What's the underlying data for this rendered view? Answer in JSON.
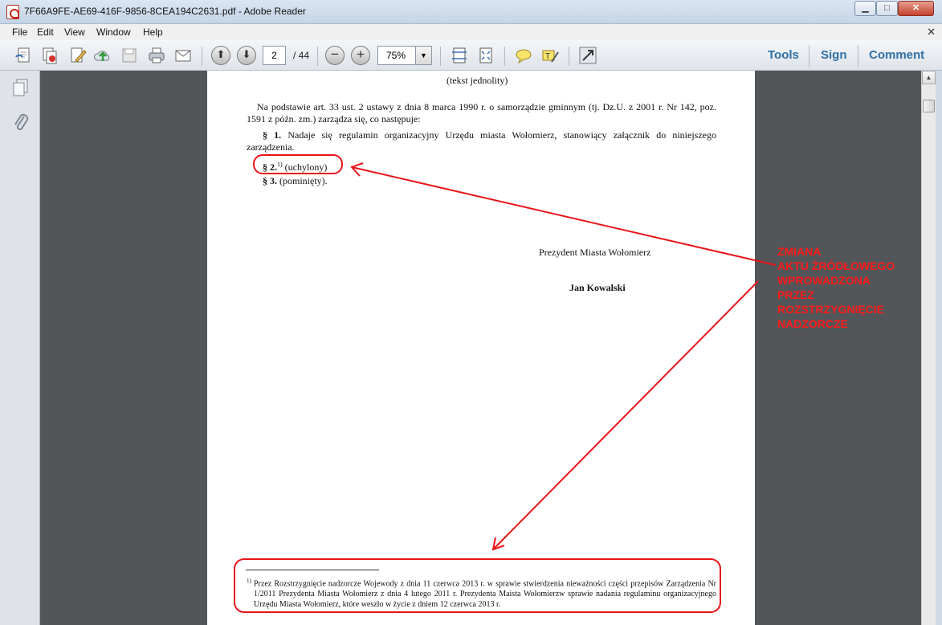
{
  "window": {
    "title": "7F66A9FE-AE69-416F-9856-8CEA194C2631.pdf - Adobe Reader",
    "min_glyph": "▁",
    "max_glyph": "□",
    "close_glyph": "✕"
  },
  "menu": {
    "items": [
      "File",
      "Edit",
      "View",
      "Window",
      "Help"
    ],
    "close_glyph": "✕"
  },
  "toolbar": {
    "icons": [
      "create-pdf-icon",
      "combine-icon",
      "edit-icon",
      "upload-icon",
      "save-icon",
      "print-icon",
      "email-icon",
      "prev-page-icon",
      "next-page-icon",
      "zoom-out-icon",
      "zoom-in-icon",
      "fit-page-icon",
      "fit-width-icon",
      "comment-bubble-icon",
      "highlight-icon",
      "fullscreen-icon"
    ],
    "page_current": "2",
    "page_total": "/ 44",
    "zoom": "75%",
    "prev_glyph": "⬆",
    "next_glyph": "⬇",
    "zoom_out_glyph": "−",
    "zoom_in_glyph": "+",
    "zoom_dropdown_glyph": "▼",
    "right_tabs": [
      "Tools",
      "Sign",
      "Comment"
    ]
  },
  "navpane": {
    "icons": [
      "pages-icon",
      "attachments-icon"
    ]
  },
  "document": {
    "subtitle": "(tekst jednolity)",
    "intro": "Na podstawie art. 33 ust. 2 ustawy z dnia 8 marca 1990 r. o samorządzie gminnym (tj. Dz.U. z 2001 r. Nr 142, poz. 1591 z późn. zm.) zarządza się, co następuje:",
    "par1_num": "§ 1.",
    "par1_text": " Nadaje się regulamin organizacyjny Urzędu miasta Wołomierz, stanowiący załącznik do niniejszego zarządzenia.",
    "par2_num": "§ 2.",
    "par2_sup": "1)",
    "par2_text": " (uchylony)",
    "par3_num": "§ 3.",
    "par3_text": " (pominięty).",
    "signature_title": "Prezydent Miasta Wołomierz",
    "signature_name": "Jan Kowalski",
    "footnote_mark": "1)",
    "footnote": "Przez Rozstrzygnięcie nadzorcze Wojewody z dnia 11 czerwca 2013 r. w sprawie stwierdzenia nieważności części przepisów Zarządzenia Nr 1/2011 Prezydenta Miasta Wołomierz z dnia 4 lutego 2011 r. Prezydenta Maista Wołomierzw sprawie nadania regulaminu organizacyjnego Urzędu Miasta Wołomierz, które weszło w życie z dniem 12 czerwca 2013 r."
  },
  "scrollbar": {
    "up_glyph": "▲"
  },
  "annotation": {
    "label": "ZMIANA\nAKTU ŹRÓDŁOWEGO\nWPROWADZONA\nPRZEZ\nROZSTRZYGNIĘCIE\nNADZORCZE",
    "color": "#ff1a1a"
  }
}
